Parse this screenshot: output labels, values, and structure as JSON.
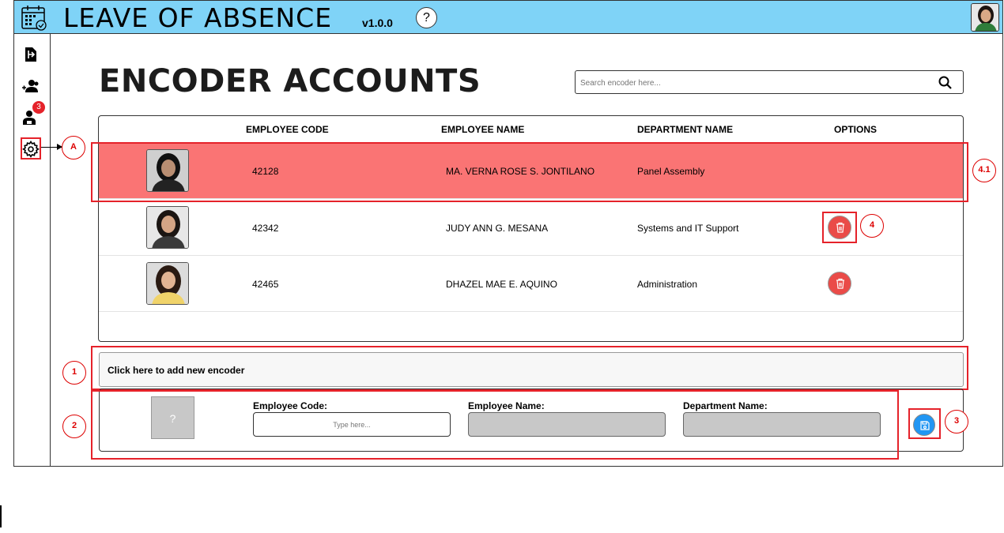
{
  "app": {
    "title": "LEAVE OF ABSENCE",
    "version": "v1.0.0",
    "help": "?"
  },
  "sidebar": {
    "items": [
      {
        "icon": "leave-document-icon"
      },
      {
        "icon": "users-icon"
      },
      {
        "icon": "approver-icon",
        "badge": "3"
      },
      {
        "icon": "gear-icon"
      }
    ]
  },
  "page": {
    "title": "ENCODER ACCOUNTS"
  },
  "search": {
    "placeholder": "Search encoder here..."
  },
  "table": {
    "headers": [
      "EMPLOYEE CODE",
      "EMPLOYEE NAME",
      "DEPARTMENT NAME",
      "OPTIONS"
    ],
    "rows": [
      {
        "code": "42128",
        "name": "MA. VERNA ROSE S. JONTILANO",
        "department": "Panel Assembly",
        "highlighted": true
      },
      {
        "code": "42342",
        "name": "JUDY ANN G. MESANA",
        "department": "Systems and IT Support",
        "highlighted": false
      },
      {
        "code": "42465",
        "name": "DHAZEL MAE E. AQUINO",
        "department": "Administration",
        "highlighted": false
      }
    ]
  },
  "add_bar": {
    "label": "Click here to add new encoder"
  },
  "form": {
    "photo_placeholder": "?",
    "code_label": "Employee Code:",
    "code_placeholder": "Type here...",
    "name_label": "Employee Name:",
    "dept_label": "Department Name:"
  },
  "annotations": {
    "a": "A",
    "one": "1",
    "two": "2",
    "three": "3",
    "four": "4",
    "four_one": "4.1"
  },
  "colors": {
    "topbar": "#7fd3f7",
    "highlight_row": "#fa7474",
    "delete_button": "#ea4b48",
    "save_button": "#2196f3",
    "annotation": "#e5222a"
  }
}
